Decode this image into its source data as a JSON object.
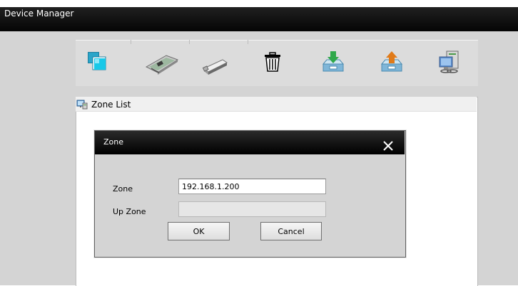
{
  "app": {
    "title": "Device Manager"
  },
  "toolbar": {
    "icons": [
      {
        "name": "copy-zone-icon"
      },
      {
        "name": "network-card-icon"
      },
      {
        "name": "usb-device-icon"
      },
      {
        "name": "delete-icon"
      },
      {
        "name": "import-icon"
      },
      {
        "name": "export-icon"
      },
      {
        "name": "network-computer-icon"
      }
    ]
  },
  "zone_list": {
    "title": "Zone List"
  },
  "dialog": {
    "title": "Zone",
    "zone_label": "Zone",
    "zone_value": "192.168.1.200",
    "up_zone_label": "Up Zone",
    "up_zone_value": "",
    "ok_label": "OK",
    "cancel_label": "Cancel"
  },
  "colors": {
    "titlebar": "#000000",
    "toolbar_bg": "#dcdcdc",
    "dialog_bg": "#d4d4d4",
    "accent_green": "#2fa84a",
    "accent_orange": "#e07b1a"
  }
}
